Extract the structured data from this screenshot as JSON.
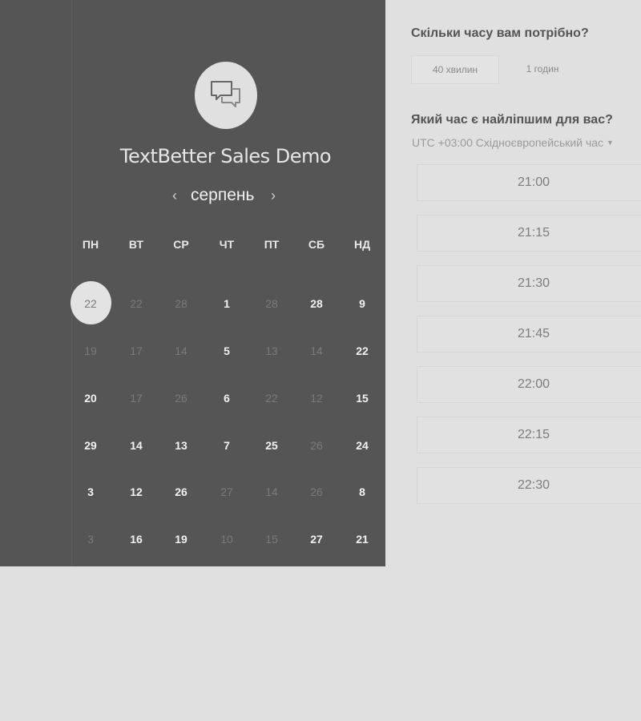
{
  "event": {
    "title": "TextBetter Sales Demo",
    "logo_icon": "chat-bubbles-icon"
  },
  "calendar": {
    "month": "серпень",
    "prev_icon": "chevron-left-icon",
    "next_icon": "chevron-right-icon",
    "weekdays": [
      "ПН",
      "ВТ",
      "СР",
      "ЧТ",
      "ПТ",
      "СБ",
      "НД"
    ],
    "weeks": [
      [
        {
          "label": "22",
          "available": false,
          "selected": true
        },
        {
          "label": "22",
          "available": false
        },
        {
          "label": "28",
          "available": false
        },
        {
          "label": "1",
          "available": true
        },
        {
          "label": "28",
          "available": false
        },
        {
          "label": "28",
          "available": true
        },
        {
          "label": "9",
          "available": true
        }
      ],
      [
        {
          "label": "19",
          "available": false
        },
        {
          "label": "17",
          "available": false
        },
        {
          "label": "14",
          "available": false
        },
        {
          "label": "5",
          "available": true
        },
        {
          "label": "13",
          "available": false
        },
        {
          "label": "14",
          "available": false
        },
        {
          "label": "22",
          "available": true
        }
      ],
      [
        {
          "label": "20",
          "available": true
        },
        {
          "label": "17",
          "available": false
        },
        {
          "label": "26",
          "available": false
        },
        {
          "label": "6",
          "available": true
        },
        {
          "label": "22",
          "available": false
        },
        {
          "label": "12",
          "available": false
        },
        {
          "label": "15",
          "available": true
        }
      ],
      [
        {
          "label": "29",
          "available": true
        },
        {
          "label": "14",
          "available": true
        },
        {
          "label": "13",
          "available": true
        },
        {
          "label": "7",
          "available": true
        },
        {
          "label": "25",
          "available": true
        },
        {
          "label": "26",
          "available": false
        },
        {
          "label": "24",
          "available": true
        }
      ],
      [
        {
          "label": "3",
          "available": true
        },
        {
          "label": "12",
          "available": true
        },
        {
          "label": "26",
          "available": true
        },
        {
          "label": "27",
          "available": false
        },
        {
          "label": "14",
          "available": false
        },
        {
          "label": "26",
          "available": false
        },
        {
          "label": "8",
          "available": true
        }
      ],
      [
        {
          "label": "3",
          "available": false
        },
        {
          "label": "16",
          "available": true
        },
        {
          "label": "19",
          "available": true
        },
        {
          "label": "10",
          "available": false
        },
        {
          "label": "15",
          "available": false
        },
        {
          "label": "27",
          "available": true
        },
        {
          "label": "21",
          "available": true
        }
      ]
    ]
  },
  "duration": {
    "question": "Скільки часу вам потрібно?",
    "options": [
      "40 хвилин",
      "1 годин"
    ],
    "selected_index": 0
  },
  "time": {
    "question": "Який час є найліпшим для вас?",
    "timezone": "UTC +03:00 Східноєвропейський час",
    "timezone_caret_icon": "caret-down-icon",
    "slots": [
      "21:00",
      "21:15",
      "21:30",
      "21:45",
      "22:00",
      "22:15",
      "22:30"
    ]
  },
  "colors": {
    "left_panel_bg": "#555555",
    "page_bg": "#e0e0e0",
    "available_day": "#f2f2f2",
    "unavailable_day": "#7a7a7a"
  }
}
